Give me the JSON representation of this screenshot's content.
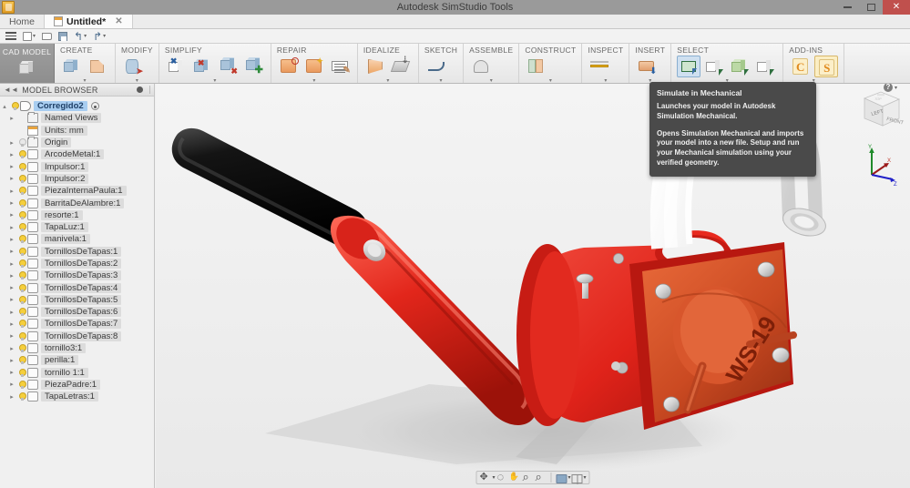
{
  "window": {
    "title": "Autodesk SimStudio Tools",
    "app_icon": "simstudio-app-icon",
    "minimize": "–",
    "maximize": "❐",
    "close": "✕"
  },
  "tabs": [
    {
      "label": "Home",
      "active": false,
      "closable": false
    },
    {
      "label": "Untitled*",
      "active": true,
      "closable": true,
      "close_label": "✕"
    }
  ],
  "quick_access": [
    {
      "name": "app-menu",
      "icon": "hamburger-icon"
    },
    {
      "name": "new",
      "icon": "new-document-icon",
      "has_caret": true
    },
    {
      "name": "open",
      "icon": "open-folder-icon"
    },
    {
      "name": "save",
      "icon": "save-disk-icon"
    },
    {
      "name": "undo",
      "icon": "undo-arrow-icon",
      "has_caret": true
    },
    {
      "name": "redo",
      "icon": "redo-arrow-icon",
      "has_caret": true
    }
  ],
  "ribbon": {
    "cad_model_label": "CAD MODEL",
    "groups": [
      {
        "id": "create",
        "label": "CREATE",
        "items": [
          {
            "name": "create-solid",
            "icon": "blue-cube-icon"
          },
          {
            "name": "create-surface",
            "icon": "orange-face-icon"
          }
        ]
      },
      {
        "id": "modify",
        "label": "MODIFY",
        "items": [
          {
            "name": "modify-body",
            "icon": "blue-cylinder-icon"
          }
        ]
      },
      {
        "id": "simplify",
        "label": "SIMPLIFY",
        "items": [
          {
            "name": "remove-face",
            "icon": "white-face-delete-icon"
          },
          {
            "name": "delete-body",
            "icon": "blue-body-delete-icon"
          },
          {
            "name": "remove-detail",
            "icon": "cube-remove-icon"
          },
          {
            "name": "add-detail",
            "icon": "cube-add-icon"
          }
        ]
      },
      {
        "id": "repair",
        "label": "REPAIR",
        "items": [
          {
            "name": "find-problems",
            "icon": "magnify-repair-icon"
          },
          {
            "name": "auto-repair",
            "icon": "star-repair-icon"
          },
          {
            "name": "repair-report",
            "icon": "edit-lines-icon"
          }
        ]
      },
      {
        "id": "idealize",
        "label": "IDEALIZE",
        "items": [
          {
            "name": "midsurface",
            "icon": "flag-surface-icon"
          },
          {
            "name": "offset-stack",
            "icon": "stacked-layers-icon"
          }
        ]
      },
      {
        "id": "sketch",
        "label": "SKETCH",
        "items": [
          {
            "name": "sketch-spline",
            "icon": "spline-curve-icon"
          }
        ]
      },
      {
        "id": "assemble",
        "label": "ASSEMBLE",
        "items": [
          {
            "name": "assemble-parts",
            "icon": "double-arch-icon"
          }
        ]
      },
      {
        "id": "construct",
        "label": "CONSTRUCT",
        "items": [
          {
            "name": "construct-plane",
            "icon": "two-plate-icon"
          }
        ]
      },
      {
        "id": "inspect",
        "label": "INSPECT",
        "items": [
          {
            "name": "measure",
            "icon": "ruler-icon"
          }
        ]
      },
      {
        "id": "insert",
        "label": "INSERT",
        "items": [
          {
            "name": "insert-component",
            "icon": "import-printer-icon"
          }
        ]
      },
      {
        "id": "select",
        "label": "SELECT",
        "items": [
          {
            "name": "select-window",
            "icon": "select-rectangle-icon",
            "state": "selected"
          },
          {
            "name": "select-face",
            "icon": "select-face-icon"
          },
          {
            "name": "select-body",
            "icon": "select-body-icon"
          },
          {
            "name": "select-edge",
            "icon": "select-edge-icon"
          }
        ]
      },
      {
        "id": "add-ins",
        "label": "ADD-INS",
        "items": [
          {
            "name": "simulate-cfd",
            "icon": "addin-c-icon",
            "glyph": "C"
          },
          {
            "name": "simulate-mechanical",
            "icon": "addin-s-icon",
            "glyph": "S",
            "state": "hover"
          }
        ]
      }
    ]
  },
  "tooltip": {
    "title": "Simulate in Mechanical",
    "paragraph1": "Launches your model in Autodesk Simulation Mechanical.",
    "paragraph2": "Opens Simulation Mechanical and imports your model into a new file. Setup and run your Mechanical simulation using your verified geometry."
  },
  "browser": {
    "header": "MODEL BROWSER",
    "tree": [
      {
        "level": 0,
        "label": "Corregido2",
        "icon": "assembly-icon",
        "bulb": "on",
        "arrow": "▴",
        "root": true,
        "end_mark": true
      },
      {
        "level": 1,
        "label": "Named Views",
        "icon": "folder-icon",
        "bulb": "none",
        "arrow": "▸"
      },
      {
        "level": 1,
        "label": "Units:  mm",
        "icon": "document-icon",
        "bulb": "none",
        "arrow": ""
      },
      {
        "level": 1,
        "label": "Origin",
        "icon": "folder-icon",
        "bulb": "off",
        "arrow": "▸"
      },
      {
        "level": 1,
        "label": "ArcodeMetal:1",
        "icon": "component-icon",
        "bulb": "on",
        "arrow": "▸"
      },
      {
        "level": 1,
        "label": "Impulsor:1",
        "icon": "component-icon",
        "bulb": "on",
        "arrow": "▸"
      },
      {
        "level": 1,
        "label": "Impulsor:2",
        "icon": "component-icon",
        "bulb": "on",
        "arrow": "▸"
      },
      {
        "level": 1,
        "label": "PiezaInternaPaula:1",
        "icon": "component-icon",
        "bulb": "on",
        "arrow": "▸"
      },
      {
        "level": 1,
        "label": "BarritaDeAlambre:1",
        "icon": "component-icon",
        "bulb": "on",
        "arrow": "▸"
      },
      {
        "level": 1,
        "label": "resorte:1",
        "icon": "component-icon",
        "bulb": "on",
        "arrow": "▸"
      },
      {
        "level": 1,
        "label": "TapaLuz:1",
        "icon": "component-icon",
        "bulb": "on",
        "arrow": "▸"
      },
      {
        "level": 1,
        "label": "manivela:1",
        "icon": "component-icon",
        "bulb": "on",
        "arrow": "▸"
      },
      {
        "level": 1,
        "label": "TornillosDeTapas:1",
        "icon": "component-icon",
        "bulb": "on",
        "arrow": "▸"
      },
      {
        "level": 1,
        "label": "TornillosDeTapas:2",
        "icon": "component-icon",
        "bulb": "on",
        "arrow": "▸"
      },
      {
        "level": 1,
        "label": "TornillosDeTapas:3",
        "icon": "component-icon",
        "bulb": "on",
        "arrow": "▸"
      },
      {
        "level": 1,
        "label": "TornillosDeTapas:4",
        "icon": "component-icon",
        "bulb": "on",
        "arrow": "▸"
      },
      {
        "level": 1,
        "label": "TornillosDeTapas:5",
        "icon": "component-icon",
        "bulb": "on",
        "arrow": "▸"
      },
      {
        "level": 1,
        "label": "TornillosDeTapas:6",
        "icon": "component-icon",
        "bulb": "on",
        "arrow": "▸"
      },
      {
        "level": 1,
        "label": "TornillosDeTapas:7",
        "icon": "component-icon",
        "bulb": "on",
        "arrow": "▸"
      },
      {
        "level": 1,
        "label": "TornillosDeTapas:8",
        "icon": "component-icon",
        "bulb": "on",
        "arrow": "▸"
      },
      {
        "level": 1,
        "label": "tornillo3:1",
        "icon": "component-icon",
        "bulb": "on",
        "arrow": "▸"
      },
      {
        "level": 1,
        "label": "perilla:1",
        "icon": "component-icon",
        "bulb": "on",
        "arrow": "▸"
      },
      {
        "level": 1,
        "label": "tornillo 1:1",
        "icon": "component-icon",
        "bulb": "on",
        "arrow": "▸"
      },
      {
        "level": 1,
        "label": "PiezaPadre:1",
        "icon": "component-icon",
        "bulb": "on",
        "arrow": "▸"
      },
      {
        "level": 1,
        "label": "TapaLetras:1",
        "icon": "component-icon",
        "bulb": "on",
        "arrow": "▸"
      }
    ]
  },
  "canvas": {
    "model_label": "WS-19",
    "view_cube": {
      "front_face": "FRONT",
      "left_face": "LEFT",
      "top_face": "TOP"
    },
    "axis": {
      "x": "X",
      "y": "Y",
      "z": "Z"
    },
    "help_glyph": "?",
    "colors": {
      "body_red": "#e02a22",
      "body_red_dark": "#a8160f",
      "cover_orange": "#cf4a25",
      "handle_black": "#161616",
      "spout_white": "#f7f7f7",
      "metal": "#cfcfcf",
      "background": "#efefef"
    }
  },
  "nav_bar": [
    {
      "name": "pan-tool",
      "icon": "pan-icon",
      "caret": true
    },
    {
      "name": "orbit-tool",
      "icon": "orbit-icon",
      "caret": false
    },
    {
      "name": "look-tool",
      "icon": "hand-icon",
      "caret": false
    },
    {
      "name": "zoom-in-tool",
      "icon": "zoom-in-icon",
      "caret": false
    },
    {
      "name": "zoom-fit-tool",
      "icon": "zoom-fit-icon",
      "caret": false
    },
    {
      "name": "display-settings",
      "icon": "display-icon",
      "caret": true
    },
    {
      "name": "grid-settings",
      "icon": "grid-icon",
      "caret": true
    }
  ]
}
